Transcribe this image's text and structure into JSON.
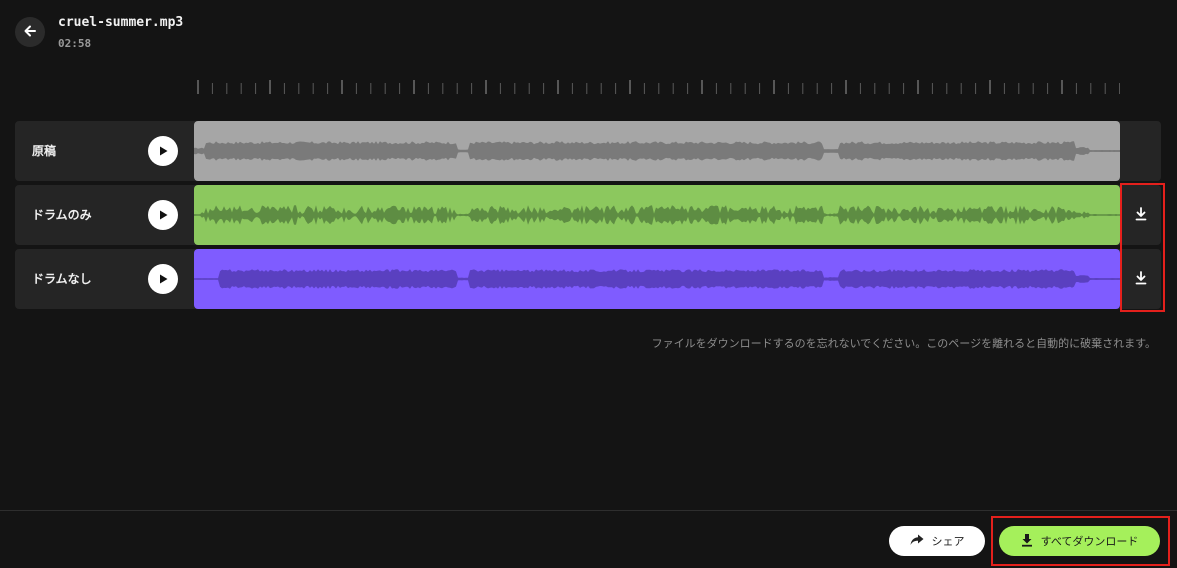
{
  "header": {
    "back_icon": "arrow-left-icon",
    "file_name": "cruel-summer.mp3",
    "duration": "02:58"
  },
  "tracks": [
    {
      "label": "原稿",
      "wave_bg": "#a6a6a6",
      "wave_fg": "#7a7a7a",
      "downloadable": false
    },
    {
      "label": "ドラムのみ",
      "wave_bg": "#8cc85e",
      "wave_fg": "#5e8d43",
      "downloadable": true
    },
    {
      "label": "ドラムなし",
      "wave_bg": "#7f5cff",
      "wave_fg": "#5a40c0",
      "downloadable": true
    }
  ],
  "notice": "ファイルをダウンロードするのを忘れないでください。このページを離れると自動的に破棄されます。",
  "footer": {
    "share_label": "シェア",
    "download_all_label": "すべてダウンロード"
  },
  "colors": {
    "accent": "#a5f05b",
    "highlight": "#e4201c",
    "background": "#141414"
  }
}
